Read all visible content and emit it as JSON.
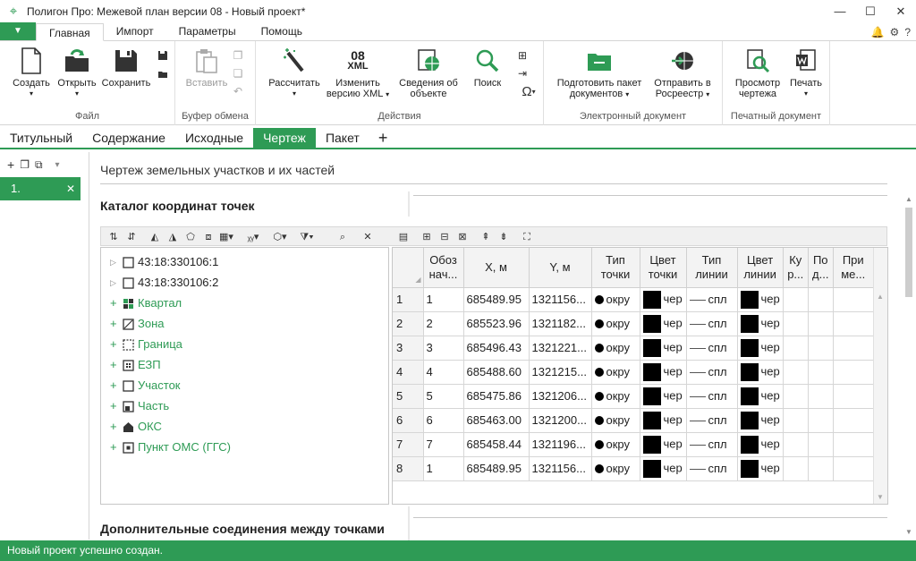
{
  "window": {
    "title": "Полигон Про: Межевой план версии 08 - Новый проект*",
    "controls": [
      "—",
      "☐",
      "✕"
    ]
  },
  "ribbon_tabs": [
    "Главная",
    "Импорт",
    "Параметры",
    "Помощь"
  ],
  "ribbon_right": [
    "🔔",
    "⚙",
    "?"
  ],
  "menu_button": "▼",
  "ribbon": {
    "file": {
      "label": "Файл",
      "create": "Создать",
      "open": "Открыть",
      "save": "Сохранить"
    },
    "clipboard": {
      "label": "Буфер обмена",
      "paste": "Вставить"
    },
    "actions": {
      "label": "Действия",
      "calculate": "Рассчитать",
      "change_xml_l1": "Изменить",
      "change_xml_l2": "версию XML",
      "object_info_l1": "Сведения об",
      "object_info_l2": "объекте",
      "search": "Поиск",
      "xml_icon_top": "08",
      "xml_icon_bottom": "XML",
      "omega": "Ω"
    },
    "edoc": {
      "label": "Электронный документ",
      "prepare_l1": "Подготовить пакет",
      "prepare_l2": "документов",
      "send_l1": "Отправить в",
      "send_l2": "Росреестр"
    },
    "print": {
      "label": "Печатный документ",
      "preview_l1": "Просмотр",
      "preview_l2": "чертежа",
      "print": "Печать"
    }
  },
  "doc_tabs": [
    "Титульный",
    "Содержание",
    "Исходные",
    "Чертеж",
    "Пакет",
    "+"
  ],
  "active_doc_tab": "Чертеж",
  "left_panel": {
    "item_label": "1.",
    "close": "✕"
  },
  "main": {
    "section_title": "Чертеж земельных участков и их частей",
    "catalog_title": "Каталог координат точек",
    "additional_title": "Дополнительные соединения между точками"
  },
  "tree": {
    "items": [
      {
        "label": "43:18:330106:1",
        "kind": "parcel"
      },
      {
        "label": "43:18:330106:2",
        "kind": "parcel"
      },
      {
        "label": "Квартал",
        "kind": "group"
      },
      {
        "label": "Зона",
        "kind": "group"
      },
      {
        "label": "Граница",
        "kind": "group"
      },
      {
        "label": "ЕЗП",
        "kind": "group"
      },
      {
        "label": "Участок",
        "kind": "group"
      },
      {
        "label": "Часть",
        "kind": "group"
      },
      {
        "label": "ОКС",
        "kind": "group"
      },
      {
        "label": "Пункт ОМС (ГГС)",
        "kind": "group"
      }
    ]
  },
  "table": {
    "headers": [
      [
        "Обоз",
        "нач..."
      ],
      [
        "X, м"
      ],
      [
        "Y, м"
      ],
      [
        "Тип",
        "точки"
      ],
      [
        "Цвет",
        "точки"
      ],
      [
        "Тип",
        "линии"
      ],
      [
        "Цвет",
        "линии"
      ],
      [
        "Ку",
        "р..."
      ],
      [
        "По",
        "д..."
      ],
      [
        "При",
        "ме..."
      ]
    ],
    "rows": [
      {
        "n": "1",
        "name": "1",
        "x": "685489.95",
        "y": "1321156...",
        "ptype": "окру",
        "pcolor": "чер",
        "ltype": "спл",
        "lcolor": "чер"
      },
      {
        "n": "2",
        "name": "2",
        "x": "685523.96",
        "y": "1321182...",
        "ptype": "окру",
        "pcolor": "чер",
        "ltype": "спл",
        "lcolor": "чер"
      },
      {
        "n": "3",
        "name": "3",
        "x": "685496.43",
        "y": "1321221...",
        "ptype": "окру",
        "pcolor": "чер",
        "ltype": "спл",
        "lcolor": "чер"
      },
      {
        "n": "4",
        "name": "4",
        "x": "685488.60",
        "y": "1321215...",
        "ptype": "окру",
        "pcolor": "чер",
        "ltype": "спл",
        "lcolor": "чер"
      },
      {
        "n": "5",
        "name": "5",
        "x": "685475.86",
        "y": "1321206...",
        "ptype": "окру",
        "pcolor": "чер",
        "ltype": "спл",
        "lcolor": "чер"
      },
      {
        "n": "6",
        "name": "6",
        "x": "685463.00",
        "y": "1321200...",
        "ptype": "окру",
        "pcolor": "чер",
        "ltype": "спл",
        "lcolor": "чер"
      },
      {
        "n": "7",
        "name": "7",
        "x": "685458.44",
        "y": "1321196...",
        "ptype": "окру",
        "pcolor": "чер",
        "ltype": "спл",
        "lcolor": "чер"
      },
      {
        "n": "8",
        "name": "1",
        "x": "685489.95",
        "y": "1321156...",
        "ptype": "окру",
        "pcolor": "чер",
        "ltype": "спл",
        "lcolor": "чер"
      }
    ]
  },
  "status": {
    "text": "Новый проект успешно создан."
  },
  "colors": {
    "accent": "#2e9b55"
  }
}
